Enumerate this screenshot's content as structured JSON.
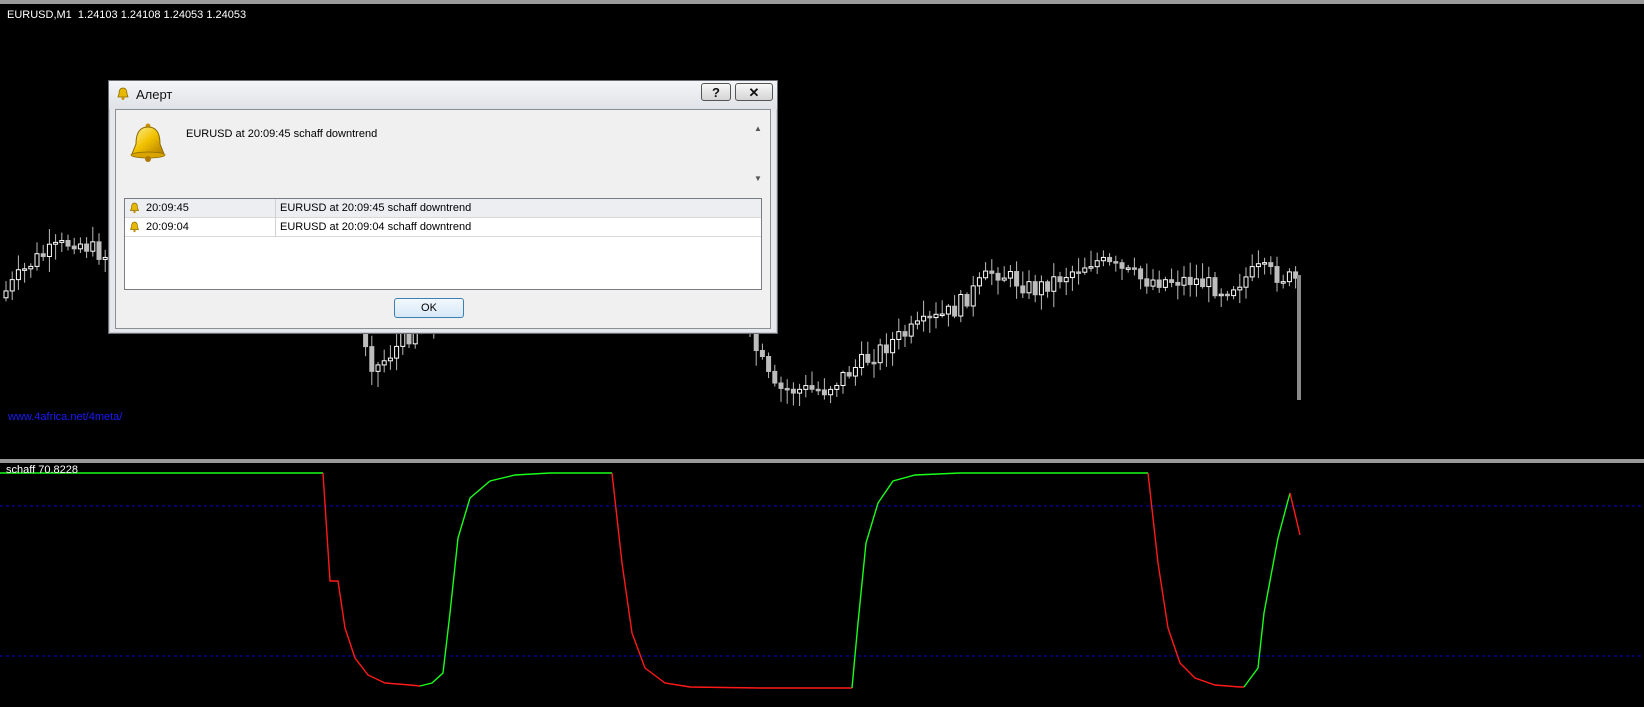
{
  "chart": {
    "symbol_info": "EURUSD,M1  1.24103 1.24108 1.24053 1.24053",
    "watermark": "www.4africa.net/4meta/",
    "oscillator_label": "schaff 70.8228",
    "colors": {
      "background": "#000000",
      "candle": "#bdbdbd",
      "osc_up": "#19ff19",
      "osc_down": "#ff1a1a",
      "level_line": "#0000cc"
    }
  },
  "dialog": {
    "title": "Алерт",
    "help_label": "?",
    "close_label": "✕",
    "message": "EURUSD at 20:09:45 schaff downtrend",
    "alerts": [
      {
        "time": "20:09:45",
        "message": "EURUSD at 20:09:45 schaff downtrend"
      },
      {
        "time": "20:09:04",
        "message": "EURUSD at 20:09:04 schaff downtrend"
      }
    ],
    "ok_label": "OK",
    "icons": [
      "bell-icon",
      "help-icon",
      "close-icon",
      "scroll-up-icon",
      "scroll-down-icon"
    ]
  }
}
